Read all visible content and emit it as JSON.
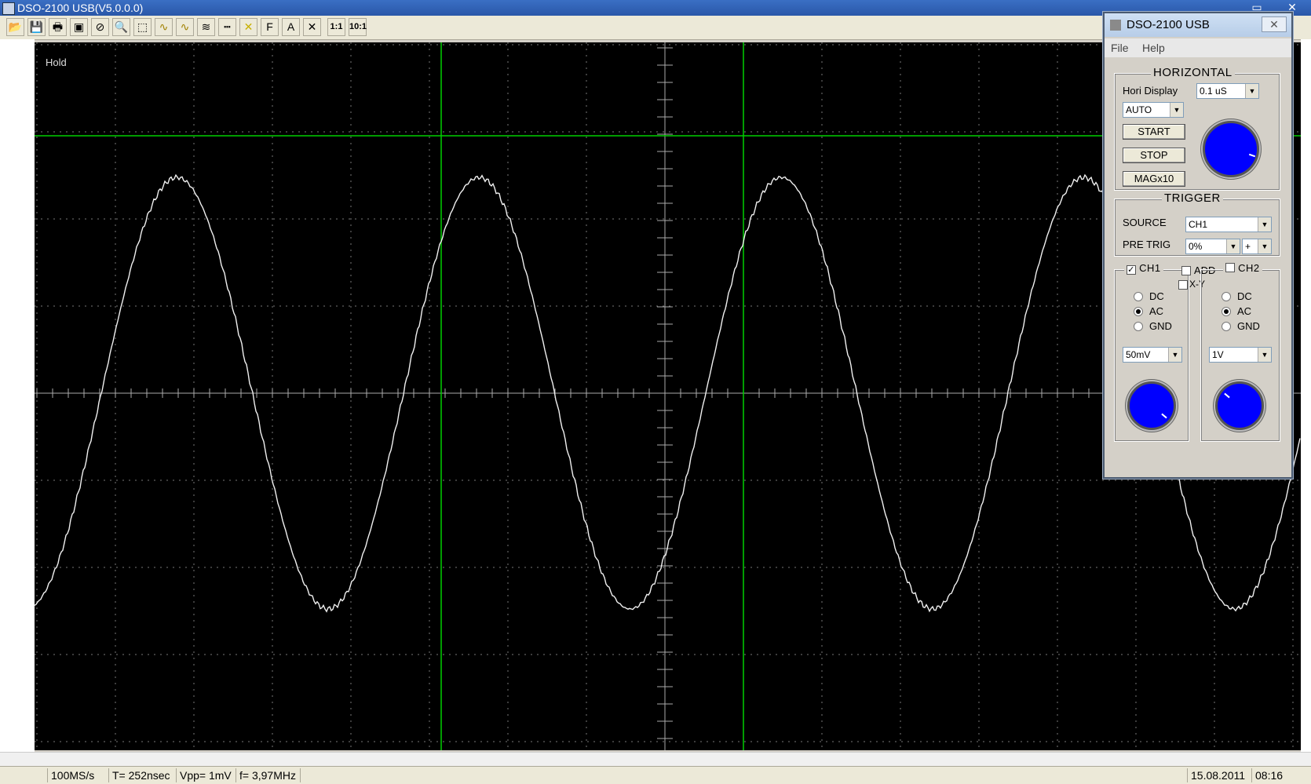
{
  "window": {
    "title": "DSO-2100 USB(V5.0.0.0)"
  },
  "toolbar": {
    "buttons": [
      {
        "icon": "open-folder-icon",
        "glyph": "📂"
      },
      {
        "icon": "save-icon",
        "glyph": "💾"
      },
      {
        "icon": "print-icon",
        "glyph": "🖶"
      },
      {
        "icon": "capture-icon",
        "glyph": "▣"
      },
      {
        "icon": "stop-icon",
        "glyph": "⊘"
      },
      {
        "icon": "zoom-icon",
        "glyph": "🔍"
      },
      {
        "icon": "grid-icon",
        "glyph": "⬚"
      },
      {
        "icon": "wave-icon",
        "glyph": "∿"
      },
      {
        "icon": "wave-yellow-icon",
        "glyph": "∿"
      },
      {
        "icon": "filter-icon",
        "glyph": "≋"
      },
      {
        "icon": "dashed-line-icon",
        "glyph": "┅"
      },
      {
        "icon": "cross-yellow-icon",
        "glyph": "✕"
      },
      {
        "icon": "fft-icon",
        "glyph": "F"
      },
      {
        "icon": "auto-set-icon",
        "glyph": "A"
      },
      {
        "icon": "cursor-icon",
        "glyph": "✕"
      }
    ],
    "ratio_1": "1:1",
    "ratio_10": "10:1"
  },
  "scope": {
    "hold_label": "Hold"
  },
  "status": {
    "sample_rate": "100MS/s",
    "period": "T= 252nsec",
    "vpp": "Vpp= 1mV",
    "frequency": "f= 3,97MHz",
    "date": "15.08.2011",
    "time": "08:16"
  },
  "panel": {
    "title": "DSO-2100 USB",
    "close": "✕",
    "menu": {
      "file": "File",
      "help": "Help"
    },
    "horizontal": {
      "title": "HORIZONTAL",
      "hori_display_label": "Hori Display",
      "hori_display_value": "AUTO",
      "timebase_value": "0.1 uS",
      "start": "START",
      "stop": "STOP",
      "mag": "MAGx10"
    },
    "trigger": {
      "title": "TRIGGER",
      "source_label": "SOURCE",
      "source_value": "CH1",
      "pretrig_label": "PRE TRIG",
      "pretrig_value": "0%",
      "slope_value": "+"
    },
    "channels": {
      "ch1": "CH1",
      "add": "ADD",
      "ch2": "CH2",
      "xy": "X-Y",
      "dc": "DC",
      "ac": "AC",
      "gnd": "GND",
      "ch1_volts": "50mV",
      "ch2_volts": "1V"
    }
  }
}
